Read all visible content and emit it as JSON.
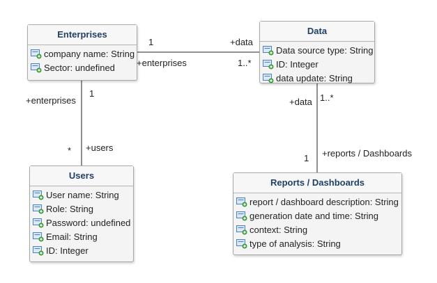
{
  "diagram": {
    "classes": {
      "enterprises": {
        "name": "Enterprises",
        "attributes": [
          "company name: String",
          "Sector: undefined"
        ]
      },
      "data": {
        "name": "Data",
        "attributes": [
          "Data source type: String",
          "ID: Integer",
          "data update: String"
        ]
      },
      "users": {
        "name": "Users",
        "attributes": [
          "User name: String",
          "Role: String",
          "Password: undefined",
          "Email: String",
          "ID: Integer"
        ]
      },
      "reports": {
        "name": "Reports / Dashboards",
        "attributes": [
          "report / dashboard description: String",
          "generation date and time: String",
          "context: String",
          "type of analysis: String"
        ]
      }
    },
    "associations": {
      "enterprises_data": {
        "multiplicity_enterprises": "1",
        "role_data": "+data",
        "role_enterprises": "+enterprises",
        "multiplicity_data": "1..*"
      },
      "enterprises_users": {
        "role_enterprises": "+enterprises",
        "multiplicity_enterprises": "1",
        "multiplicity_users": "*",
        "role_users": "+users"
      },
      "data_reports": {
        "role_data": "+data",
        "multiplicity_data": "1..*",
        "multiplicity_reports": "1",
        "role_reports": "+reports / Dashboards"
      }
    },
    "colors": {
      "class_title": "#1f3f66",
      "class_fill": "#f4f4f4",
      "class_border": "#a8a8a8",
      "line": "#222222",
      "attribute_icon_blue": "#4a7fc1",
      "attribute_icon_green": "#3a9a3a"
    },
    "icons": {
      "attribute": "attribute-plus-icon"
    }
  }
}
